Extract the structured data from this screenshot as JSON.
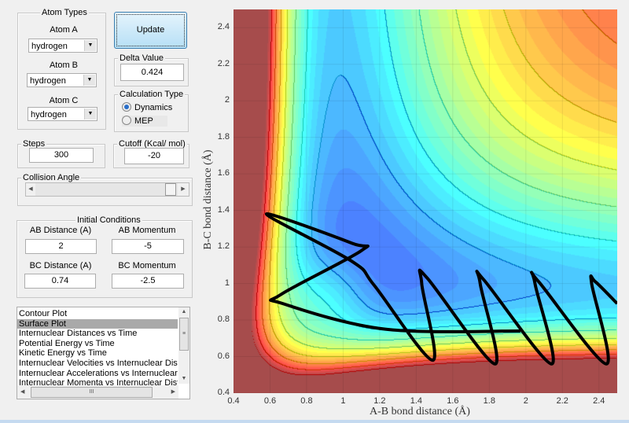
{
  "atom_types": {
    "title": "Atom Types",
    "atoms": [
      {
        "label": "Atom A",
        "value": "hydrogen"
      },
      {
        "label": "Atom B",
        "value": "hydrogen"
      },
      {
        "label": "Atom C",
        "value": "hydrogen"
      }
    ]
  },
  "update_label": "Update",
  "delta": {
    "title": "Delta Value",
    "value": "0.424"
  },
  "calc_type": {
    "title": "Calculation Type",
    "options": [
      "Dynamics",
      "MEP"
    ],
    "selected": "Dynamics"
  },
  "steps": {
    "title": "Steps",
    "value": "300"
  },
  "cutoff": {
    "title": "Cutoff (Kcal/ mol)",
    "value": "-20"
  },
  "collision_angle": {
    "title": "Collision Angle",
    "slider_position": 1.0
  },
  "initial": {
    "title": "Initial Conditions",
    "ab_dist_label": "AB Distance (A)",
    "ab_dist": "2",
    "ab_mom_label": "AB Momentum",
    "ab_mom": "-5",
    "bc_dist_label": "BC Distance (A)",
    "bc_dist": "0.74",
    "bc_mom_label": "BC Momentum",
    "bc_mom": "-2.5"
  },
  "plot_list": {
    "items": [
      "Contour Plot",
      "Surface Plot",
      "Internuclear Distances vs Time",
      "Potential Energy vs Time",
      "Kinetic Energy vs Time",
      "Internuclear Velocities vs Internuclear Distance",
      "Internuclear Accelerations vs Internuclear Distance",
      "Internuclear Momenta vs Internuclear Distance"
    ],
    "selected": "Surface Plot"
  },
  "chart_data": {
    "type": "heatmap",
    "xlabel": "A-B bond distance (Å)",
    "ylabel": "B-C bond distance (Å)",
    "xlim": [
      0.4,
      2.5
    ],
    "ylim": [
      0.4,
      2.5
    ],
    "xticks": [
      "0.4",
      "0.6",
      "0.8",
      "1",
      "1.2",
      "1.4",
      "1.6",
      "1.8",
      "2",
      "2.2",
      "2.4"
    ],
    "yticks": [
      "0.4",
      "0.6",
      "0.8",
      "1",
      "1.2",
      "1.4",
      "1.6",
      "1.8",
      "2",
      "2.2",
      "2.4"
    ],
    "colormap": "jet",
    "grid": true,
    "trajectory": [
      [
        1.97,
        0.74
      ],
      [
        1.23,
        0.75
      ],
      [
        0.67,
        0.89
      ],
      [
        0.66,
        0.94
      ],
      [
        1.1,
        1.18
      ],
      [
        1.05,
        1.22
      ],
      [
        0.58,
        1.38
      ],
      [
        1.05,
        1.12
      ],
      [
        1.17,
        0.99
      ],
      [
        1.49,
        0.58
      ],
      [
        1.43,
        1.0
      ],
      [
        1.46,
        1.03
      ],
      [
        1.83,
        0.56
      ],
      [
        1.75,
        1.0
      ],
      [
        1.77,
        1.02
      ],
      [
        2.14,
        0.56
      ],
      [
        2.05,
        1.0
      ],
      [
        2.07,
        1.01
      ],
      [
        2.44,
        0.56
      ],
      [
        2.36,
        1.0
      ],
      [
        2.38,
        1.01
      ],
      [
        2.5,
        0.89
      ]
    ]
  }
}
